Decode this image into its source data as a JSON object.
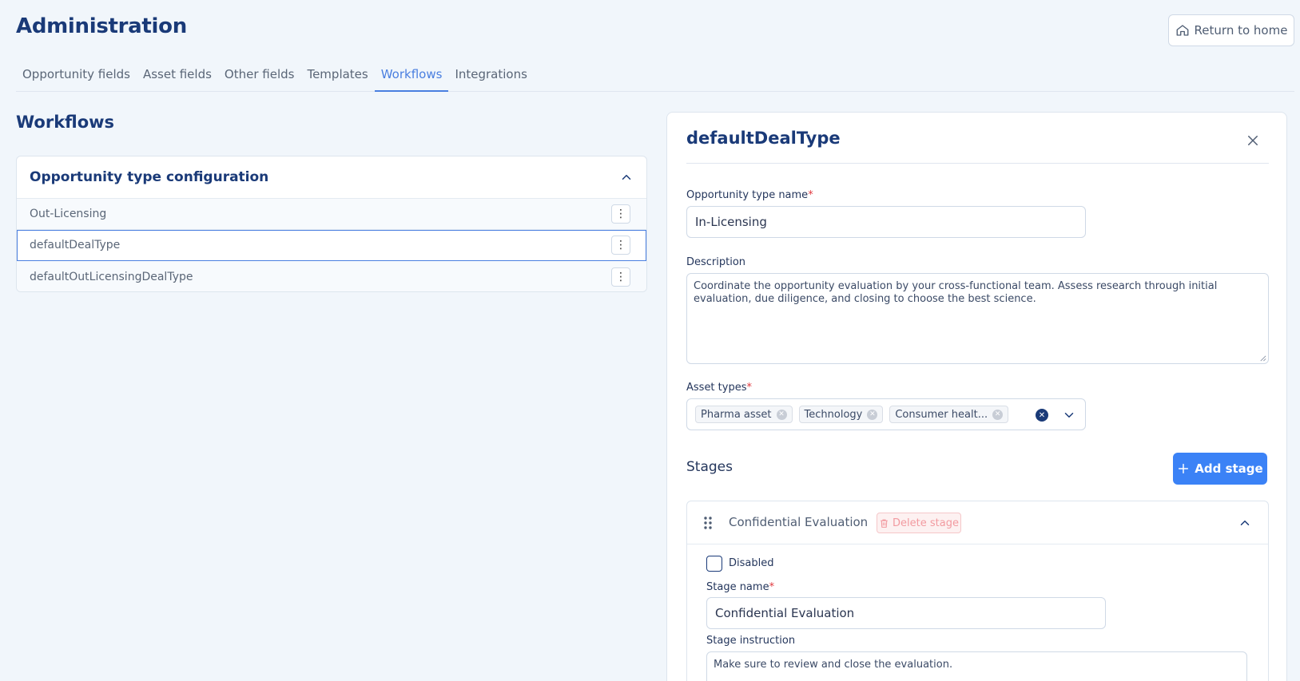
{
  "header": {
    "title": "Administration",
    "return_home": "Return to home"
  },
  "tabs": [
    {
      "label": "Opportunity fields",
      "active": false
    },
    {
      "label": "Asset fields",
      "active": false
    },
    {
      "label": "Other fields",
      "active": false
    },
    {
      "label": "Templates",
      "active": false
    },
    {
      "label": "Workflows",
      "active": true
    },
    {
      "label": "Integrations",
      "active": false
    }
  ],
  "section": {
    "title": "Workflows"
  },
  "config": {
    "title": "Opportunity type configuration",
    "items": [
      {
        "label": "Out-Licensing",
        "selected": false
      },
      {
        "label": "defaultDealType",
        "selected": true
      },
      {
        "label": "defaultOutLicensingDealType",
        "selected": false
      }
    ]
  },
  "detail": {
    "title": "defaultDealType",
    "name_label": "Opportunity type name",
    "name_value": "In-Licensing",
    "description_label": "Description",
    "description_value": "Coordinate the opportunity evaluation by your cross-functional team. Assess research through initial evaluation, due diligence, and closing to choose the best science.",
    "asset_types_label": "Asset types",
    "asset_types": [
      "Pharma asset",
      "Technology",
      "Consumer healt..."
    ],
    "stages_title": "Stages",
    "add_stage_label": "Add stage",
    "stage": {
      "name_header": "Confidential Evaluation",
      "delete_label": "Delete stage",
      "disabled_label": "Disabled",
      "stage_name_label": "Stage name",
      "stage_name_value": "Confidential Evaluation",
      "instruction_label": "Stage instruction",
      "instruction_value": "Make sure to review and close the evaluation."
    }
  },
  "colors": {
    "accent": "#3b82f6",
    "tab_active": "#4a7fe0",
    "title": "#1a3a78",
    "required": "#e0393e",
    "background": "#f1f6fb"
  },
  "icons": {
    "home": "home-icon",
    "close": "close-icon",
    "chevron": "chevron-up-icon",
    "dropdown": "chevron-down-icon",
    "kebab": "kebab-icon",
    "drag": "drag-handle-icon",
    "trash": "trash-icon",
    "plus": "plus-icon"
  }
}
